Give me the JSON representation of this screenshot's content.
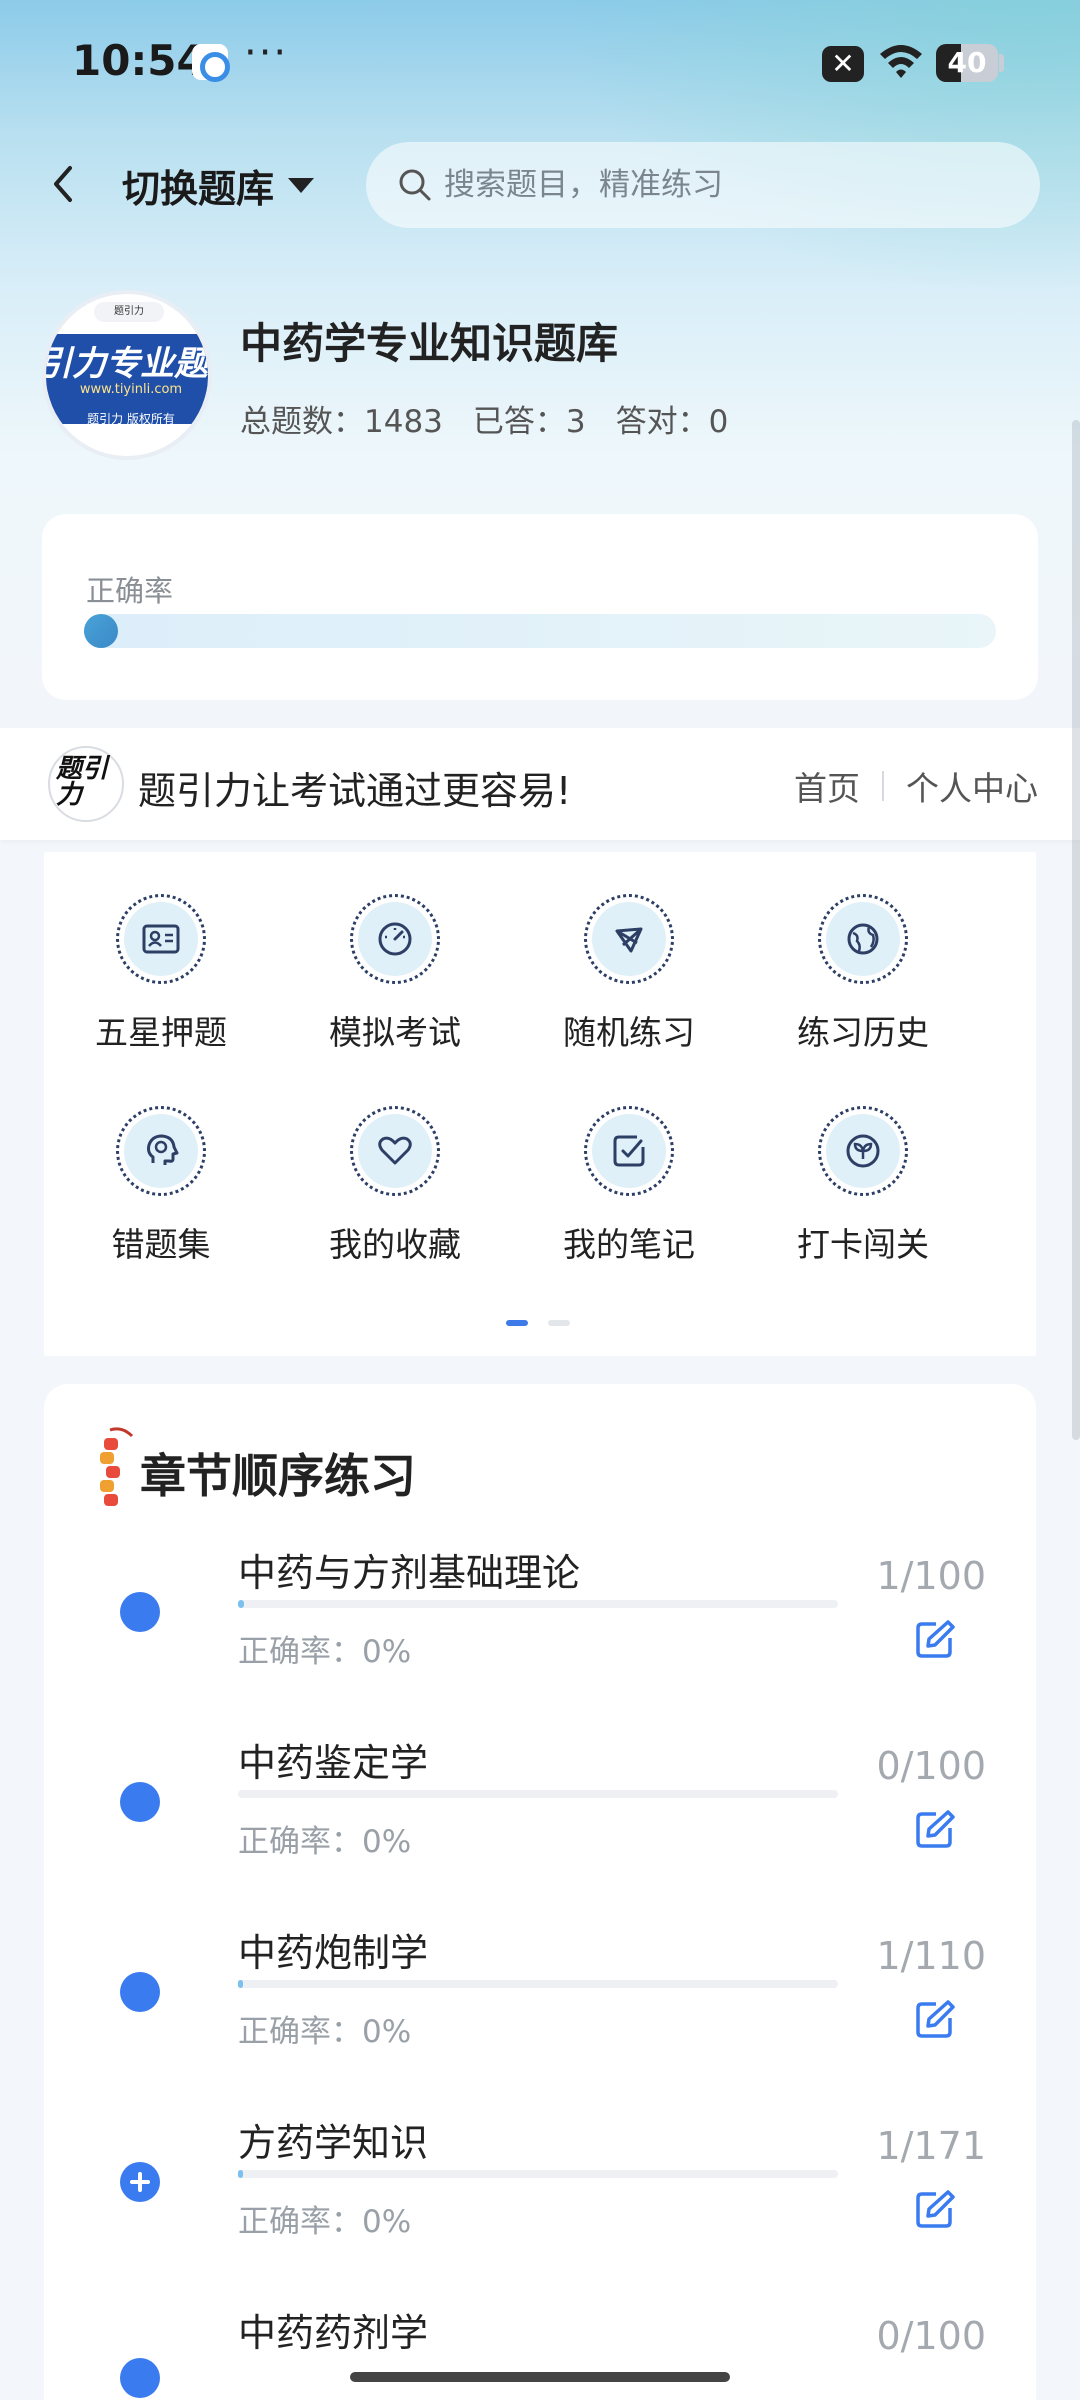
{
  "status_bar": {
    "time": "10:54",
    "more": "···",
    "x_icon": "✕",
    "battery": "40"
  },
  "header": {
    "switch_label": "切换题库",
    "search_placeholder": "搜索题目，精准练习"
  },
  "bank": {
    "title": "中药学专业知识题库",
    "logo": {
      "brand": "引力专业题",
      "url": "www.tiyinli.com",
      "copyright": "题引力 版权所有",
      "tag": "题引力"
    },
    "stats": [
      {
        "label": "总题数：1483"
      },
      {
        "label": "已答：3"
      },
      {
        "label": "答对：0"
      }
    ]
  },
  "accuracy": {
    "label": "正确率",
    "value": 0
  },
  "promo": {
    "logo_text": "题引力",
    "text": "题引力让考试通过更容易!",
    "nav": [
      {
        "label": "首页"
      },
      {
        "label": "个人中心"
      }
    ]
  },
  "tools": [
    {
      "label": "五星押题",
      "icon": "id-card-icon"
    },
    {
      "label": "模拟考试",
      "icon": "speedometer-icon"
    },
    {
      "label": "随机练习",
      "icon": "network-icon"
    },
    {
      "label": "练习历史",
      "icon": "globe-icon"
    },
    {
      "label": "错题集",
      "icon": "head-icon"
    },
    {
      "label": "我的收藏",
      "icon": "heart-icon"
    },
    {
      "label": "我的笔记",
      "icon": "note-check-icon"
    },
    {
      "label": "打卡闯关",
      "icon": "leaf-badge-icon"
    }
  ],
  "pager": {
    "pages": 2,
    "active": 0
  },
  "chapters": {
    "title": "章节顺序练习",
    "items": [
      {
        "name": "中药与方剂基础理论",
        "accuracy": "正确率：0%",
        "count": "1/100",
        "progress": 0.01,
        "bullet": "dot"
      },
      {
        "name": "中药鉴定学",
        "accuracy": "正确率：0%",
        "count": "0/100",
        "progress": 0,
        "bullet": "dot"
      },
      {
        "name": "中药炮制学",
        "accuracy": "正确率：0%",
        "count": "1/110",
        "progress": 0.009,
        "bullet": "dot"
      },
      {
        "name": "方药学知识",
        "accuracy": "正确率：0%",
        "count": "1/171",
        "progress": 0.006,
        "bullet": "plus"
      },
      {
        "name": "中药药剂学",
        "accuracy": "",
        "count": "0/100",
        "progress": 0,
        "bullet": "dot"
      }
    ]
  },
  "colors": {
    "accent": "#3a7bf0",
    "icon_ring": "#2e3f66",
    "icon_fill": "#dff0f8"
  }
}
